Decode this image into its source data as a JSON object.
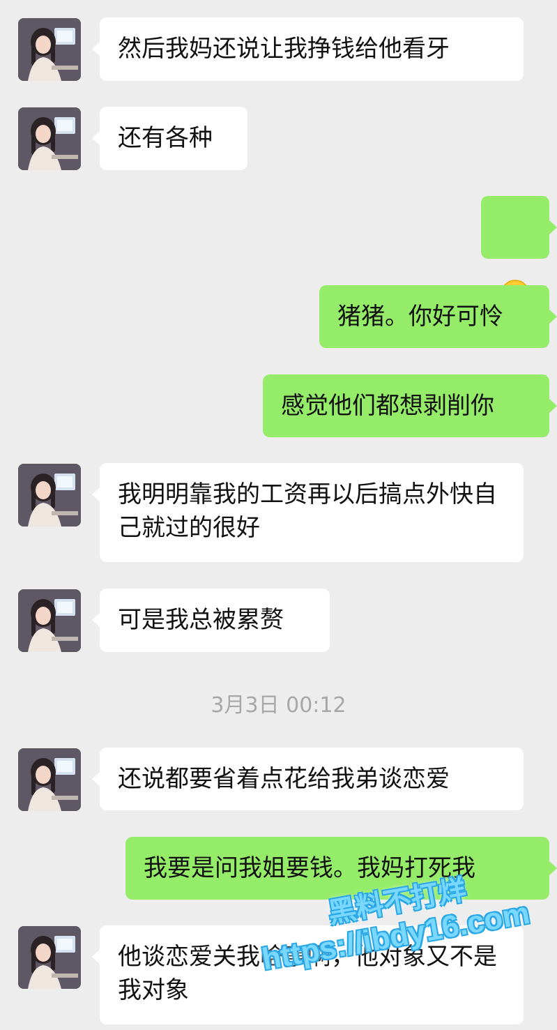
{
  "conversation": {
    "timestamp": "3月3日 00:12",
    "messages": [
      {
        "side": "in",
        "text": "然后我妈还说让我挣钱给他看牙"
      },
      {
        "side": "in",
        "text": "还有各种"
      },
      {
        "side": "out",
        "emoji": "crying-face"
      },
      {
        "side": "out",
        "text": "猪猪。你好可怜"
      },
      {
        "side": "out",
        "text": "感觉他们都想剥削你"
      },
      {
        "side": "in",
        "text": "我明明靠我的工资再以后搞点外快自己就过的很好"
      },
      {
        "side": "in",
        "text": "可是我总被累赘"
      },
      {
        "side": "in",
        "text": "还说都要省着点花给我弟谈恋爱"
      },
      {
        "side": "out",
        "text": "我要是问我姐要钱。我妈打死我"
      },
      {
        "side": "in",
        "text": "他谈恋爱关我啥事啊，他对象又不是我对象"
      }
    ]
  },
  "watermark": {
    "line1": "黑料不打烊",
    "line2": "https://ibdy16.com"
  },
  "colors": {
    "background": "#ededed",
    "incoming_bubble": "#ffffff",
    "outgoing_bubble": "#95ec69",
    "timestamp": "#a7a7a7"
  }
}
